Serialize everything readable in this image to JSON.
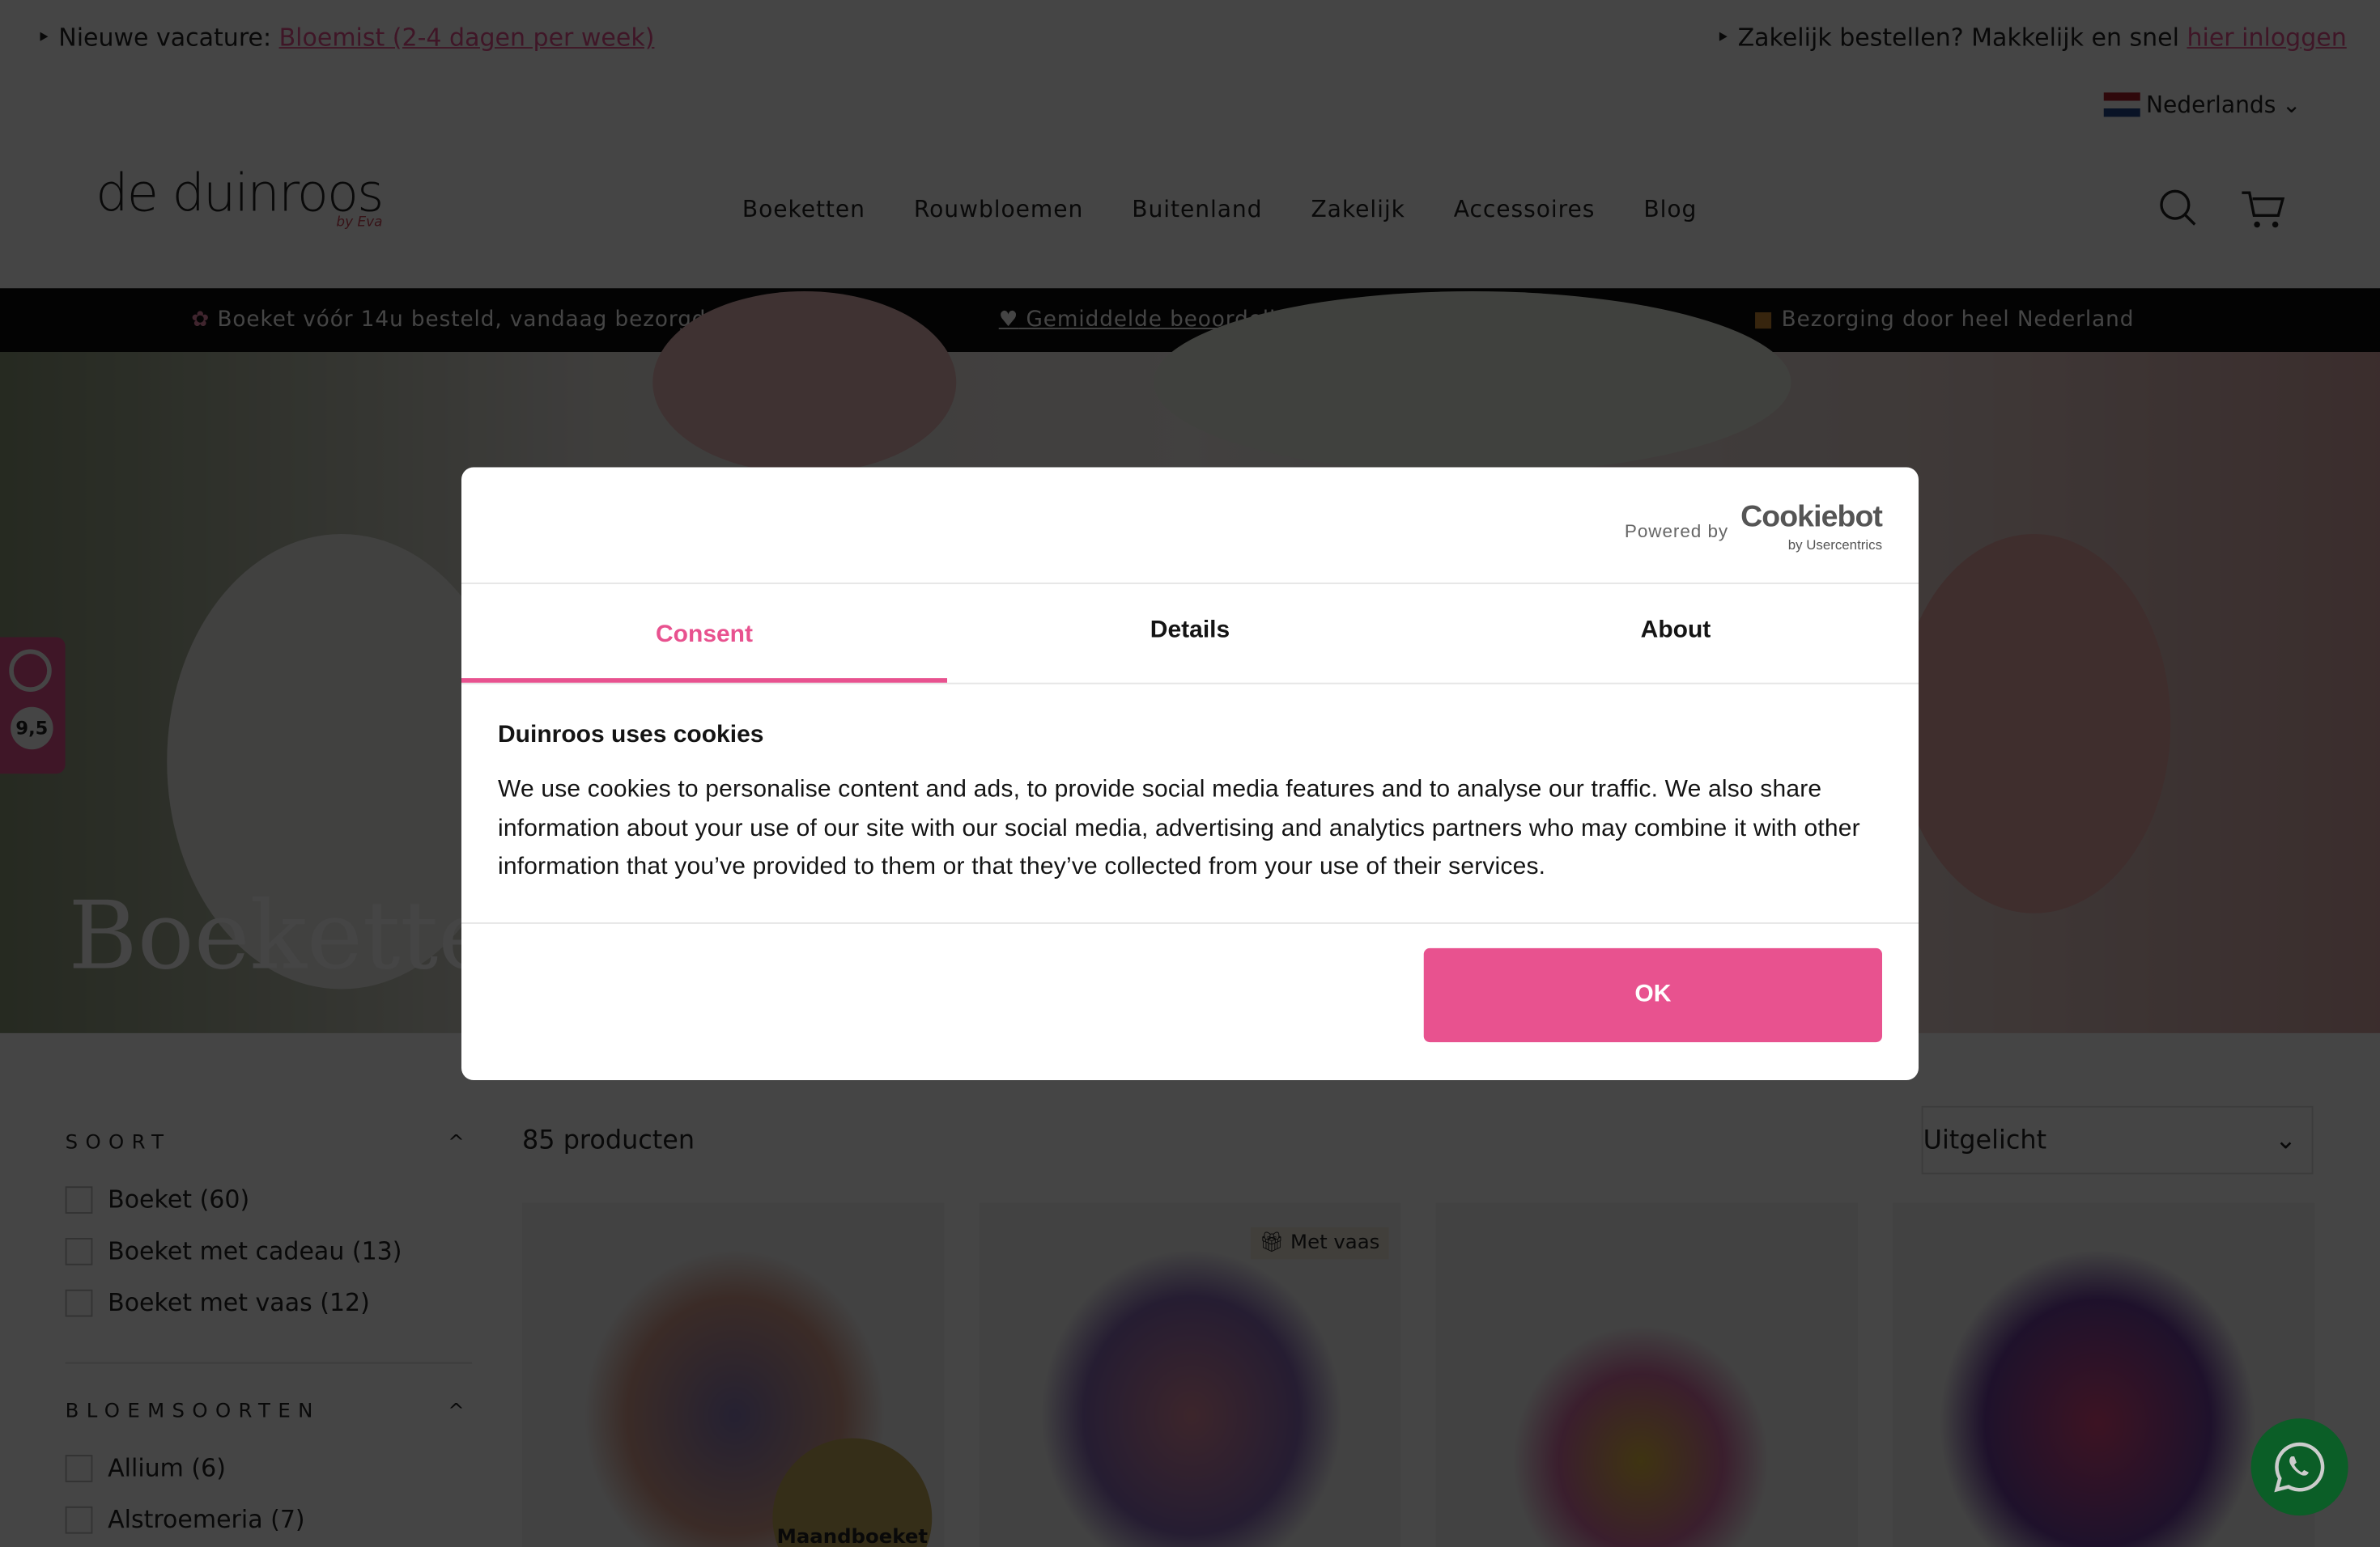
{
  "announcement": {
    "left_prefix": "Nieuwe vacature: ",
    "left_link": "Bloemist (2-4 dagen per week)",
    "right_prefix": "Zakelijk bestellen? Makkelijk en snel ",
    "right_link": "hier inloggen"
  },
  "language": {
    "selected": "Nederlands"
  },
  "logo": {
    "text": "de duinroos",
    "sub": "by Eva"
  },
  "nav": [
    "Boeketten",
    "Rouwbloemen",
    "Buitenland",
    "Zakelijk",
    "Accessoires",
    "Blog"
  ],
  "usp": [
    "Boeket vóór 14u besteld, vandaag bezorgd",
    "Gemiddelde beoordeling 9,5/10",
    "Bezorging door heel Nederland"
  ],
  "hero": {
    "title": "Boeketten"
  },
  "rating_badge": {
    "score": "9,5"
  },
  "filters": [
    {
      "title": "SOORT",
      "items": [
        "Boeket (60)",
        "Boeket met cadeau (13)",
        "Boeket met vaas (12)"
      ]
    },
    {
      "title": "BLOEMSOORTEN",
      "items": [
        "Allium (6)",
        "Alstroemeria (7)"
      ]
    }
  ],
  "products": {
    "count": "85 producten",
    "sort": "Uitgelicht",
    "badges": {
      "vase": "Met vaas",
      "monthly": "Maandboeket"
    }
  },
  "cookie": {
    "powered_by": "Powered by",
    "brand": "Cookiebot",
    "brand_sub": "by Usercentrics",
    "tabs": [
      "Consent",
      "Details",
      "About"
    ],
    "active_tab": "Consent",
    "title": "Duinroos uses cookies",
    "body": "We use cookies to personalise content and ads, to provide social media features and to analyse our traffic. We also share information about your use of our site with our social media, advertising and analytics partners who may combine it with other information that you’ve provided to them or that they’ve collected from your use of their services.",
    "ok": "OK"
  },
  "colors": {
    "accent": "#e8528f",
    "whatsapp": "#25d366"
  }
}
